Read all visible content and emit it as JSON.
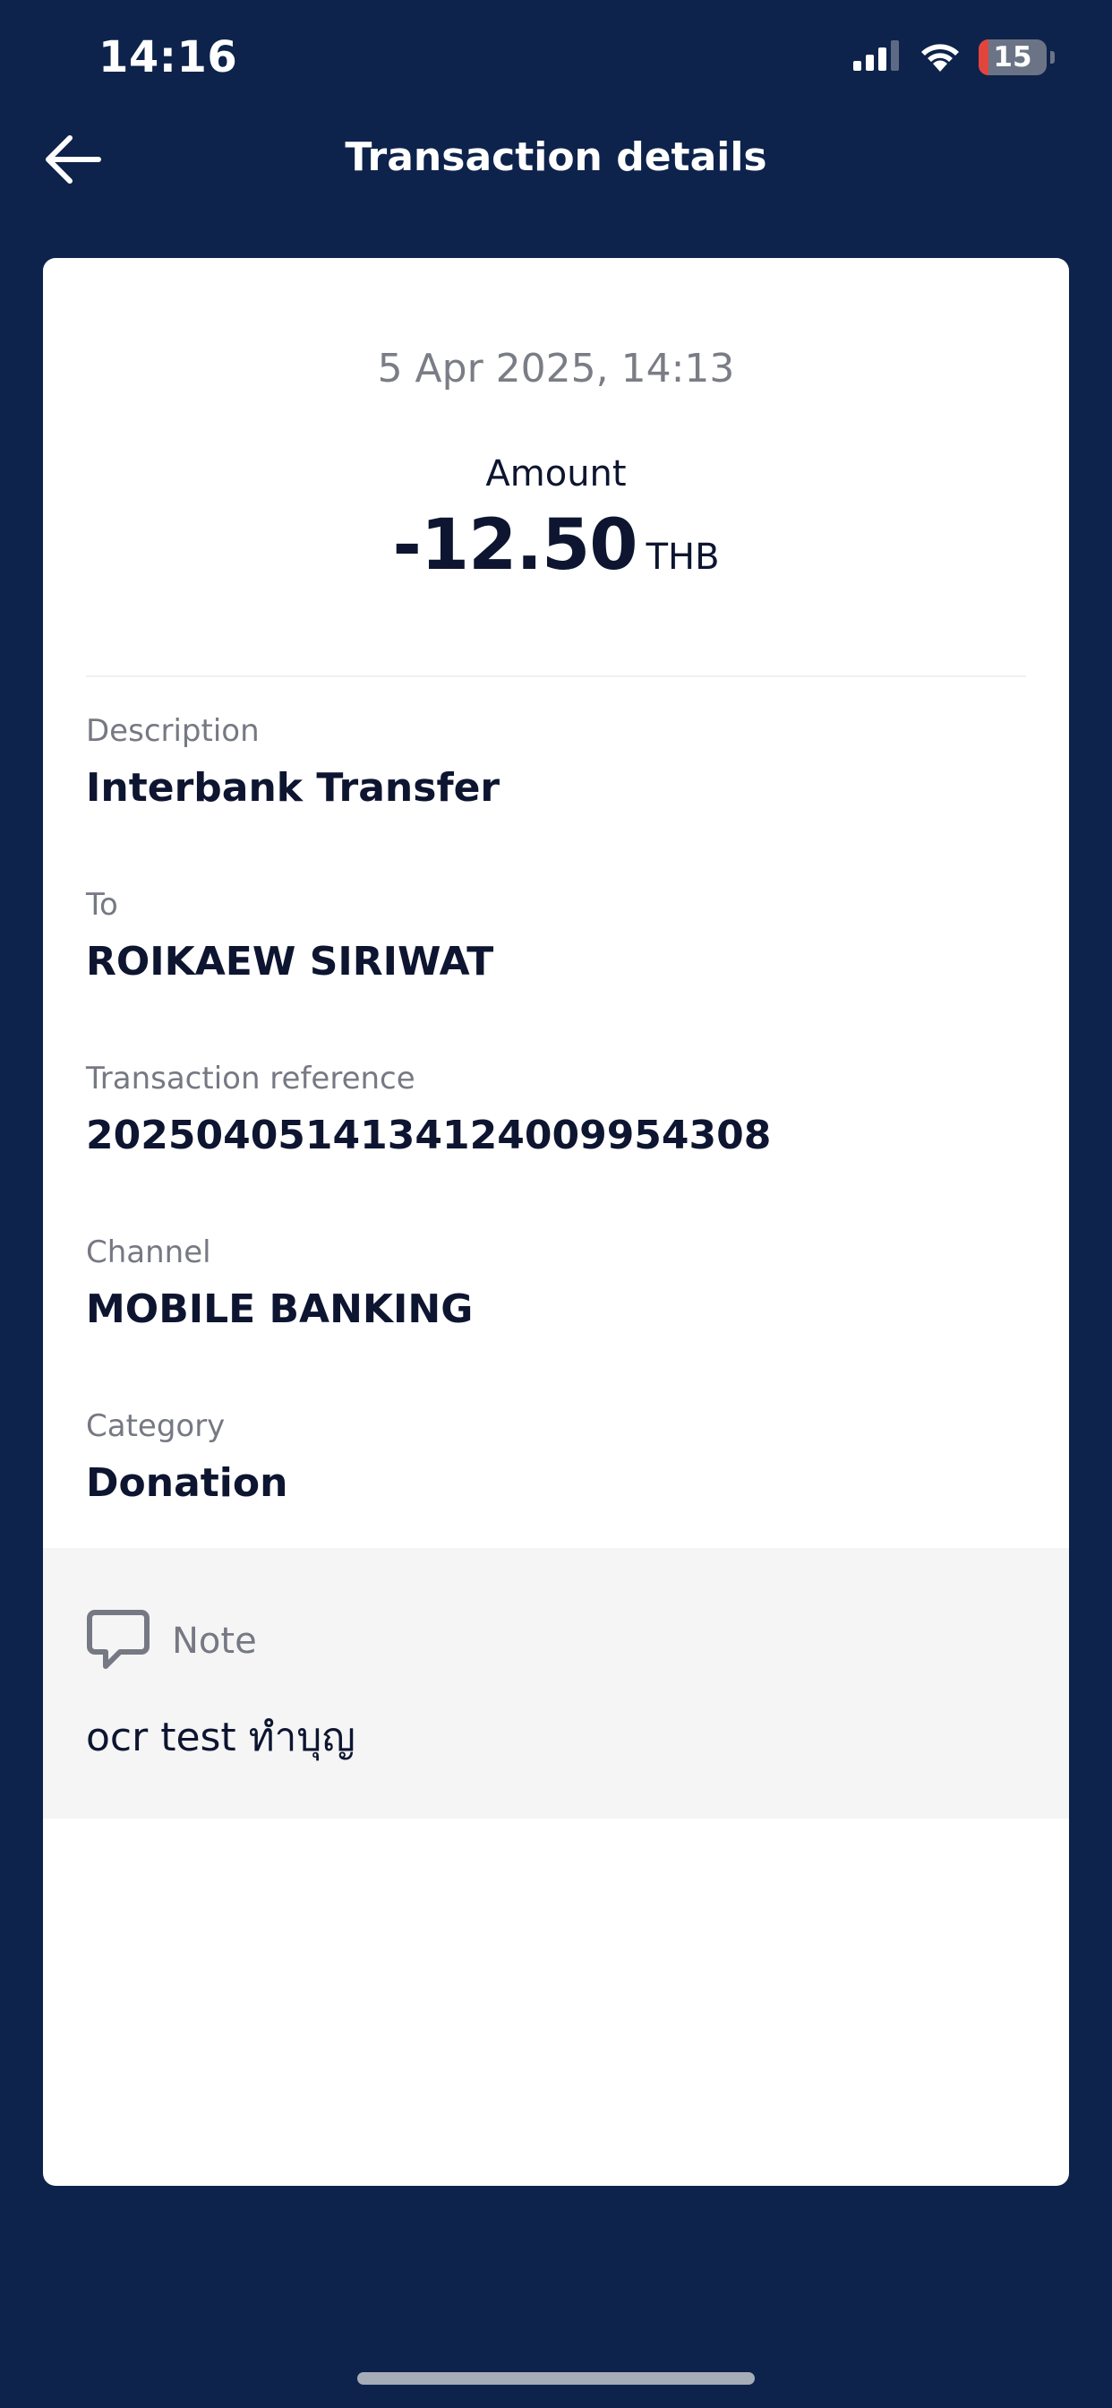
{
  "status_bar": {
    "time": "14:16",
    "battery_level": "15",
    "battery_fraction": 0.15,
    "icons": [
      "cellular-signal-icon",
      "wifi-icon",
      "battery-icon"
    ]
  },
  "header": {
    "title": "Transaction details",
    "back_icon": "arrow-left-icon"
  },
  "transaction": {
    "datetime": "5 Apr 2025, 14:13",
    "amount_label": "Amount",
    "amount": "-12.50",
    "currency": "THB",
    "fields": [
      {
        "label": "Description",
        "value": "Interbank Transfer"
      },
      {
        "label": "To",
        "value": "ROIKAEW SIRIWAT"
      },
      {
        "label": "Transaction reference",
        "value": "20250405141341240099543​08"
      },
      {
        "label": "Channel",
        "value": "MOBILE BANKING"
      },
      {
        "label": "Category",
        "value": "Donation"
      }
    ],
    "note": {
      "label": "Note",
      "icon": "speech-bubble-icon",
      "text": "ocr test ทำบุญ"
    }
  },
  "colors": {
    "background": "#0d234b",
    "card": "#ffffff",
    "primary_text": "#0d1530",
    "secondary_text": "#767983",
    "note_background": "#f5f5f5",
    "battery_low": "#e2453c"
  }
}
